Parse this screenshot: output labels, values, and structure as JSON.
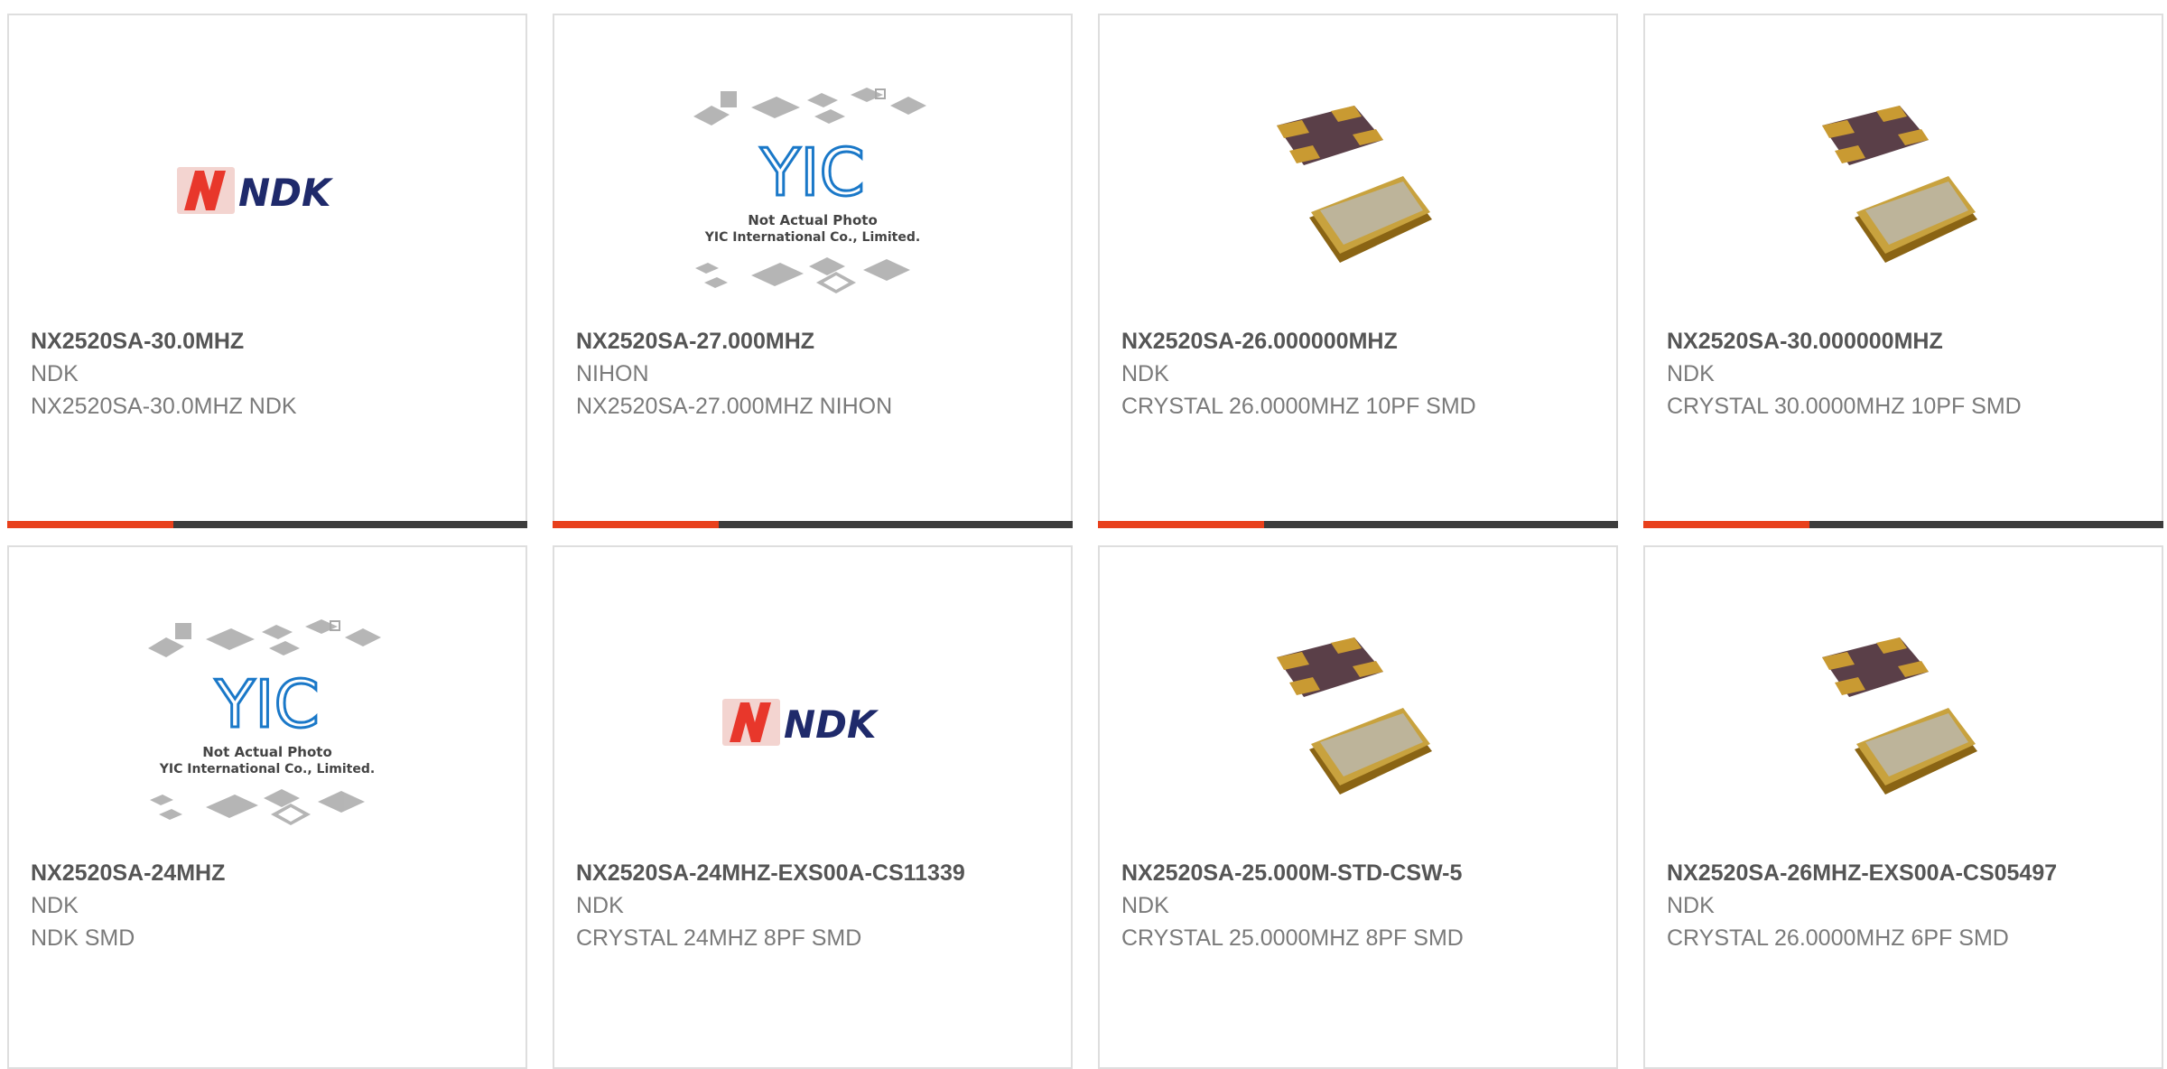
{
  "colors": {
    "card_border": "#dedede",
    "title_text": "#555555",
    "body_text": "#7a7a7a",
    "accent": "#e8401c",
    "bar_dark": "#3c3c3c",
    "yic_blue": "#1a78c8",
    "ndk_navy": "#1f2a6b",
    "ndk_red": "#e8372b"
  },
  "products": [
    {
      "part_number": "NX2520SA-30.0MHZ",
      "brand": "NDK",
      "description": "NX2520SA-30.0MHZ NDK",
      "image": "ndk-logo",
      "image_text": "NDK"
    },
    {
      "part_number": "NX2520SA-27.000MHZ",
      "brand": "NIHON",
      "description": "NX2520SA-27.000MHZ NIHON",
      "image": "yic-placeholder",
      "image_text": "YIC",
      "placeholder_line1": "Not Actual Photo",
      "placeholder_line2": "YIC International Co., Limited."
    },
    {
      "part_number": "NX2520SA-26.000000MHZ",
      "brand": "NDK",
      "description": "CRYSTAL 26.0000MHZ 10PF SMD",
      "image": "crystal-photo"
    },
    {
      "part_number": "NX2520SA-30.000000MHZ",
      "brand": "NDK",
      "description": "CRYSTAL 30.0000MHZ 10PF SMD",
      "image": "crystal-photo"
    },
    {
      "part_number": "NX2520SA-24MHZ",
      "brand": "NDK",
      "description": "NDK SMD",
      "image": "yic-placeholder",
      "image_text": "YIC",
      "placeholder_line1": "Not Actual Photo",
      "placeholder_line2": "YIC International Co., Limited."
    },
    {
      "part_number": "NX2520SA-24MHZ-EXS00A-CS11339",
      "brand": "NDK",
      "description": "CRYSTAL 24MHZ 8PF SMD",
      "image": "ndk-logo",
      "image_text": "NDK"
    },
    {
      "part_number": "NX2520SA-25.000M-STD-CSW-5",
      "brand": "NDK",
      "description": "CRYSTAL 25.0000MHZ 8PF SMD",
      "image": "crystal-photo"
    },
    {
      "part_number": "NX2520SA-26MHZ-EXS00A-CS05497",
      "brand": "NDK",
      "description": "CRYSTAL 26.0000MHZ 6PF SMD",
      "image": "crystal-photo"
    }
  ]
}
